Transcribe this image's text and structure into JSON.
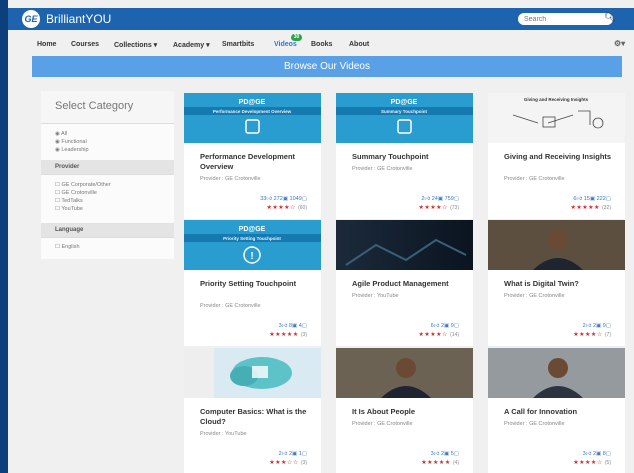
{
  "app": {
    "brand": "BrilliantYOU",
    "logo_text": "GE"
  },
  "search": {
    "placeholder": "Search"
  },
  "nav": {
    "items": [
      {
        "label": "Home",
        "id": "home"
      },
      {
        "label": "Courses",
        "id": "courses"
      },
      {
        "label": "Collections ▾",
        "id": "collections"
      },
      {
        "label": "Academy ▾",
        "id": "academy"
      },
      {
        "label": "Smartbits",
        "id": "smartbits"
      },
      {
        "label": "Videos",
        "id": "videos"
      },
      {
        "label": "Books",
        "id": "books"
      },
      {
        "label": "About",
        "id": "about"
      }
    ],
    "active": "videos",
    "videos_badge": "30"
  },
  "banner": {
    "title": "Browse Our Videos"
  },
  "sidebar": {
    "title": "Select Category",
    "categories": [
      "All",
      "Functional",
      "Leadership"
    ],
    "provider_label": "Provider",
    "providers": [
      "GE Corporate/Other",
      "GE Crotonville",
      "TedTalks",
      "YouTube"
    ],
    "language_label": "Language",
    "languages": [
      "English"
    ]
  },
  "videos": [
    {
      "title": "Performance Development Overview",
      "provider": "Provider : GE Crotonville",
      "likes": "33",
      "views": "272",
      "comments": "1049",
      "count": "(60)",
      "stars": 4,
      "thumb": "pdge",
      "thumb_caption": "Performance Development Overview"
    },
    {
      "title": "Summary Touchpoint",
      "provider": "Provider : GE Crotonville",
      "likes": "2",
      "views": "24",
      "comments": "759",
      "count": "(73)",
      "stars": 4,
      "thumb": "pdge",
      "thumb_caption": "Summary Touchpoint"
    },
    {
      "title": "Giving and Receiving Insights",
      "provider": "Provider : GE Crotonville",
      "likes": "6",
      "views": "15",
      "comments": "222",
      "count": "(32)",
      "stars": 5,
      "thumb": "whiteboard",
      "thumb_caption": "Giving and Receiving Insights"
    },
    {
      "title": "Priority Setting Touchpoint",
      "provider": "Provider : GE Crotonville",
      "likes": "3",
      "views": "8",
      "comments": "4",
      "count": "(3)",
      "stars": 5,
      "thumb": "pdge2",
      "thumb_caption": "Priority Setting Touchpoint"
    },
    {
      "title": "Agile Product Management",
      "provider": "Provider : YouTube",
      "likes": "6",
      "views": "2",
      "comments": "9",
      "count": "(14)",
      "stars": 4,
      "thumb": "dark",
      "thumb_caption": ""
    },
    {
      "title": "What is Digital Twin?",
      "provider": "Provider : GE Crotonville",
      "likes": "2",
      "views": "2",
      "comments": "9",
      "count": "(7)",
      "stars": 4,
      "thumb": "person",
      "thumb_caption": ""
    },
    {
      "title": "Computer Basics: What is the Cloud?",
      "provider": "Provider : YouTube",
      "likes": "2",
      "views": "2",
      "comments": "1",
      "count": "(3)",
      "stars": 3,
      "thumb": "cloud",
      "thumb_caption": ""
    },
    {
      "title": "It Is About People",
      "provider": "Provider : GE Crotonville",
      "likes": "3",
      "views": "2",
      "comments": "5",
      "count": "(4)",
      "stars": 5,
      "thumb": "person2",
      "thumb_caption": ""
    },
    {
      "title": "A Call for Innovation",
      "provider": "Provider : GE Crotonville",
      "likes": "3",
      "views": "2",
      "comments": "8",
      "count": "(5)",
      "stars": 4,
      "thumb": "person3",
      "thumb_caption": ""
    }
  ],
  "thumb_brand": "PD@GE",
  "colors": {
    "topbar": "#1e63ae",
    "banner": "#5aa0e6",
    "star": "#d42a2a",
    "stat": "#3a76c0",
    "pd": "#1c8bbf"
  }
}
